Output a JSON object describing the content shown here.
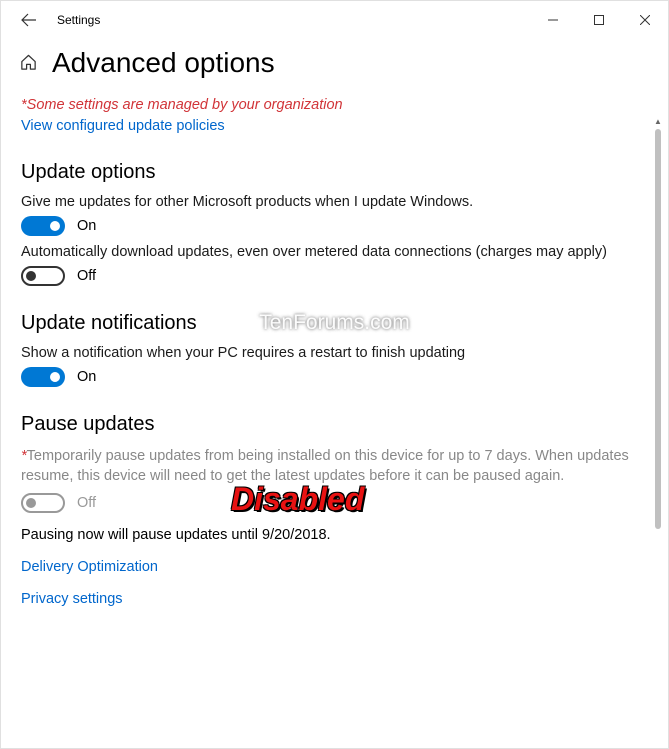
{
  "window": {
    "title": "Settings"
  },
  "page": {
    "title": "Advanced options"
  },
  "managed_notice": "*Some settings are managed by your organization",
  "view_policies_link": "View configured update policies",
  "sections": {
    "update_options": {
      "heading": "Update options",
      "opt1": {
        "label": "Give me updates for other Microsoft products when I update Windows.",
        "state": "On"
      },
      "opt2": {
        "label": "Automatically download updates, even over metered data connections (charges may apply)",
        "state": "Off"
      }
    },
    "update_notifications": {
      "heading": "Update notifications",
      "opt1": {
        "label": "Show a notification when your PC requires a restart to finish updating",
        "state": "On"
      }
    },
    "pause_updates": {
      "heading": "Pause updates",
      "description": "Temporarily pause updates from being installed on this device for up to 7 days. When updates resume, this device will need to get the latest updates before it can be paused again.",
      "toggle_state": "Off",
      "info": "Pausing now will pause updates until 9/20/2018."
    }
  },
  "links": {
    "delivery": "Delivery Optimization",
    "privacy": "Privacy settings"
  },
  "watermark": "TenForums.com",
  "stamp": "Disabled"
}
